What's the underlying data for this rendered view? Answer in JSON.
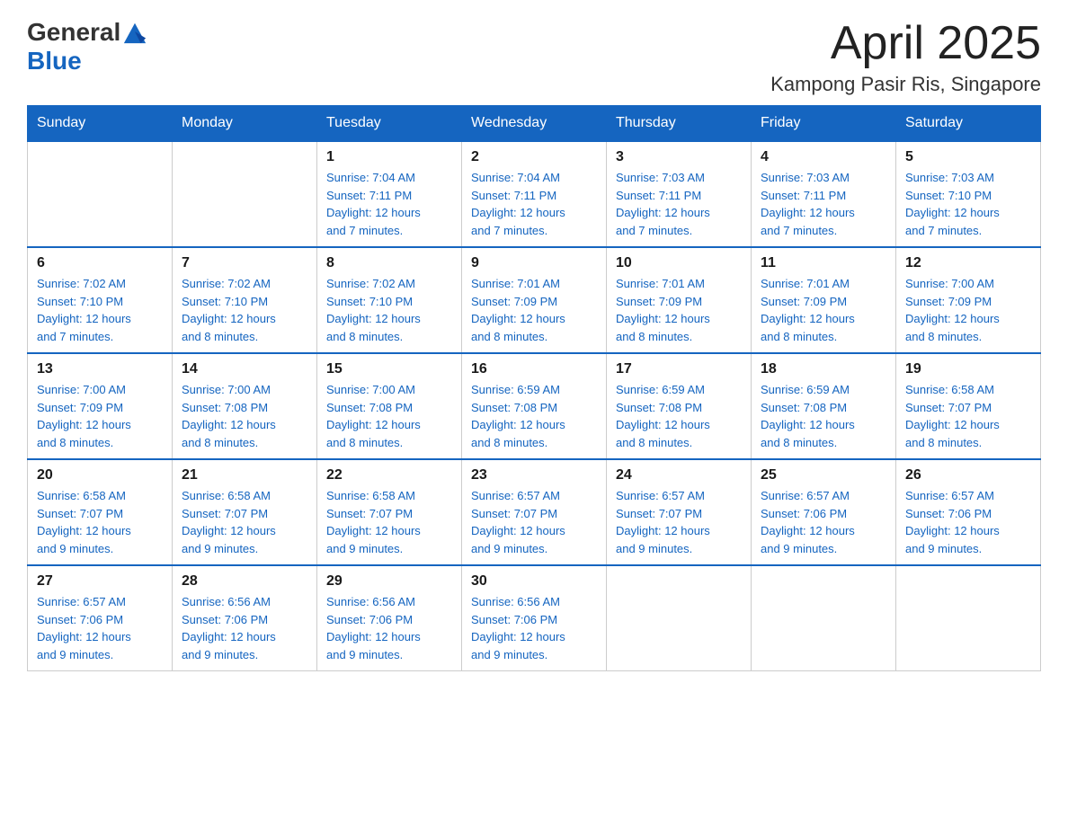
{
  "header": {
    "logo_general": "General",
    "logo_blue": "Blue",
    "month_title": "April 2025",
    "location": "Kampong Pasir Ris, Singapore"
  },
  "days_of_week": [
    "Sunday",
    "Monday",
    "Tuesday",
    "Wednesday",
    "Thursday",
    "Friday",
    "Saturday"
  ],
  "weeks": [
    [
      {
        "day": "",
        "info": ""
      },
      {
        "day": "",
        "info": ""
      },
      {
        "day": "1",
        "info": "Sunrise: 7:04 AM\nSunset: 7:11 PM\nDaylight: 12 hours\nand 7 minutes."
      },
      {
        "day": "2",
        "info": "Sunrise: 7:04 AM\nSunset: 7:11 PM\nDaylight: 12 hours\nand 7 minutes."
      },
      {
        "day": "3",
        "info": "Sunrise: 7:03 AM\nSunset: 7:11 PM\nDaylight: 12 hours\nand 7 minutes."
      },
      {
        "day": "4",
        "info": "Sunrise: 7:03 AM\nSunset: 7:11 PM\nDaylight: 12 hours\nand 7 minutes."
      },
      {
        "day": "5",
        "info": "Sunrise: 7:03 AM\nSunset: 7:10 PM\nDaylight: 12 hours\nand 7 minutes."
      }
    ],
    [
      {
        "day": "6",
        "info": "Sunrise: 7:02 AM\nSunset: 7:10 PM\nDaylight: 12 hours\nand 7 minutes."
      },
      {
        "day": "7",
        "info": "Sunrise: 7:02 AM\nSunset: 7:10 PM\nDaylight: 12 hours\nand 8 minutes."
      },
      {
        "day": "8",
        "info": "Sunrise: 7:02 AM\nSunset: 7:10 PM\nDaylight: 12 hours\nand 8 minutes."
      },
      {
        "day": "9",
        "info": "Sunrise: 7:01 AM\nSunset: 7:09 PM\nDaylight: 12 hours\nand 8 minutes."
      },
      {
        "day": "10",
        "info": "Sunrise: 7:01 AM\nSunset: 7:09 PM\nDaylight: 12 hours\nand 8 minutes."
      },
      {
        "day": "11",
        "info": "Sunrise: 7:01 AM\nSunset: 7:09 PM\nDaylight: 12 hours\nand 8 minutes."
      },
      {
        "day": "12",
        "info": "Sunrise: 7:00 AM\nSunset: 7:09 PM\nDaylight: 12 hours\nand 8 minutes."
      }
    ],
    [
      {
        "day": "13",
        "info": "Sunrise: 7:00 AM\nSunset: 7:09 PM\nDaylight: 12 hours\nand 8 minutes."
      },
      {
        "day": "14",
        "info": "Sunrise: 7:00 AM\nSunset: 7:08 PM\nDaylight: 12 hours\nand 8 minutes."
      },
      {
        "day": "15",
        "info": "Sunrise: 7:00 AM\nSunset: 7:08 PM\nDaylight: 12 hours\nand 8 minutes."
      },
      {
        "day": "16",
        "info": "Sunrise: 6:59 AM\nSunset: 7:08 PM\nDaylight: 12 hours\nand 8 minutes."
      },
      {
        "day": "17",
        "info": "Sunrise: 6:59 AM\nSunset: 7:08 PM\nDaylight: 12 hours\nand 8 minutes."
      },
      {
        "day": "18",
        "info": "Sunrise: 6:59 AM\nSunset: 7:08 PM\nDaylight: 12 hours\nand 8 minutes."
      },
      {
        "day": "19",
        "info": "Sunrise: 6:58 AM\nSunset: 7:07 PM\nDaylight: 12 hours\nand 8 minutes."
      }
    ],
    [
      {
        "day": "20",
        "info": "Sunrise: 6:58 AM\nSunset: 7:07 PM\nDaylight: 12 hours\nand 9 minutes."
      },
      {
        "day": "21",
        "info": "Sunrise: 6:58 AM\nSunset: 7:07 PM\nDaylight: 12 hours\nand 9 minutes."
      },
      {
        "day": "22",
        "info": "Sunrise: 6:58 AM\nSunset: 7:07 PM\nDaylight: 12 hours\nand 9 minutes."
      },
      {
        "day": "23",
        "info": "Sunrise: 6:57 AM\nSunset: 7:07 PM\nDaylight: 12 hours\nand 9 minutes."
      },
      {
        "day": "24",
        "info": "Sunrise: 6:57 AM\nSunset: 7:07 PM\nDaylight: 12 hours\nand 9 minutes."
      },
      {
        "day": "25",
        "info": "Sunrise: 6:57 AM\nSunset: 7:06 PM\nDaylight: 12 hours\nand 9 minutes."
      },
      {
        "day": "26",
        "info": "Sunrise: 6:57 AM\nSunset: 7:06 PM\nDaylight: 12 hours\nand 9 minutes."
      }
    ],
    [
      {
        "day": "27",
        "info": "Sunrise: 6:57 AM\nSunset: 7:06 PM\nDaylight: 12 hours\nand 9 minutes."
      },
      {
        "day": "28",
        "info": "Sunrise: 6:56 AM\nSunset: 7:06 PM\nDaylight: 12 hours\nand 9 minutes."
      },
      {
        "day": "29",
        "info": "Sunrise: 6:56 AM\nSunset: 7:06 PM\nDaylight: 12 hours\nand 9 minutes."
      },
      {
        "day": "30",
        "info": "Sunrise: 6:56 AM\nSunset: 7:06 PM\nDaylight: 12 hours\nand 9 minutes."
      },
      {
        "day": "",
        "info": ""
      },
      {
        "day": "",
        "info": ""
      },
      {
        "day": "",
        "info": ""
      }
    ]
  ]
}
